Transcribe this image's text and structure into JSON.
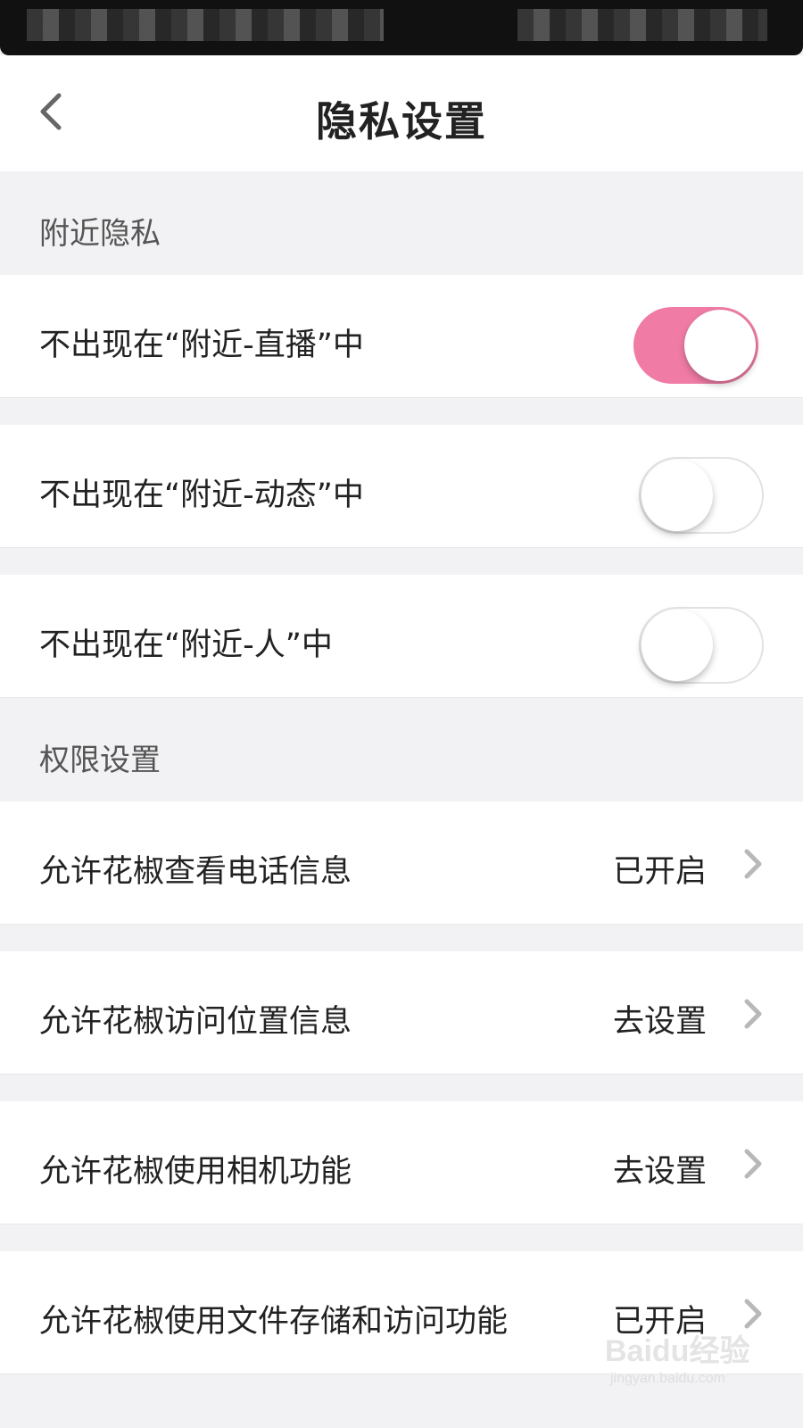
{
  "header": {
    "title": "隐私设置",
    "back_icon": "chevron-left-icon"
  },
  "sections": [
    {
      "title": "附近隐私",
      "items": [
        {
          "label": "不出现在“附近-直播”中",
          "toggle": "on"
        },
        {
          "label": "不出现在“附近-动态”中",
          "toggle": "off"
        },
        {
          "label": "不出现在“附近-人”中",
          "toggle": "off"
        }
      ]
    },
    {
      "title": "权限设置",
      "items": [
        {
          "label": "允许花椒查看电话信息",
          "value": "已开启"
        },
        {
          "label": "允许花椒访问位置信息",
          "value": "去设置"
        },
        {
          "label": "允许花椒使用相机功能",
          "value": "去设置"
        },
        {
          "label": "允许花椒使用文件存储和访问功能",
          "value": "已开启"
        }
      ]
    }
  ],
  "watermark": {
    "main": "Baidu经验",
    "sub": "jingyan.baidu.com"
  },
  "colors": {
    "toggle_on": "#f07ca6",
    "background": "#f2f2f4"
  }
}
